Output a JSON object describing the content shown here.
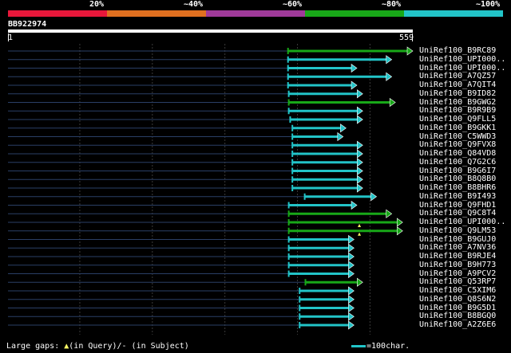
{
  "legend": {
    "labels": [
      "20%",
      "~40%",
      "~60%",
      "~80%",
      "~100%"
    ],
    "colors": [
      "#e8173a",
      "#e07020",
      "#a03a9a",
      "#18a818",
      "#22c4c8"
    ]
  },
  "query": {
    "id": "BB922974",
    "start": "1",
    "end": "559"
  },
  "hit_colors": {
    "green": "#18a818",
    "cyan": "#22c4c8",
    "gap": "#ffff66"
  },
  "hits": [
    {
      "label": "UniRef100_B9RC89",
      "start": 387,
      "end": 559,
      "color": "green"
    },
    {
      "label": "UniRef100_UPI000..",
      "start": 387,
      "end": 530,
      "color": "cyan"
    },
    {
      "label": "UniRef100_UPI000..",
      "start": 387,
      "end": 482,
      "color": "cyan"
    },
    {
      "label": "UniRef100_A7QZ57",
      "start": 387,
      "end": 530,
      "color": "cyan"
    },
    {
      "label": "UniRef100_A7QIT4",
      "start": 387,
      "end": 482,
      "color": "cyan"
    },
    {
      "label": "UniRef100_B9ID82",
      "start": 388,
      "end": 490,
      "color": "cyan"
    },
    {
      "label": "UniRef100_B9GWG2",
      "start": 388,
      "end": 535,
      "color": "green"
    },
    {
      "label": "UniRef100_B9R9B9",
      "start": 388,
      "end": 490,
      "color": "cyan"
    },
    {
      "label": "UniRef100_Q9FLL5",
      "start": 390,
      "end": 490,
      "color": "cyan"
    },
    {
      "label": "UniRef100_B9GKK1",
      "start": 393,
      "end": 467,
      "color": "cyan"
    },
    {
      "label": "UniRef100_C5WWD3",
      "start": 393,
      "end": 463,
      "color": "cyan"
    },
    {
      "label": "UniRef100_Q9FVX8",
      "start": 393,
      "end": 490,
      "color": "cyan"
    },
    {
      "label": "UniRef100_Q84VD8",
      "start": 393,
      "end": 490,
      "color": "cyan"
    },
    {
      "label": "UniRef100_Q7G2C6",
      "start": 393,
      "end": 490,
      "color": "cyan"
    },
    {
      "label": "UniRef100_B9G6I7",
      "start": 393,
      "end": 490,
      "color": "cyan"
    },
    {
      "label": "UniRef100_B8Q8B0",
      "start": 393,
      "end": 490,
      "color": "cyan"
    },
    {
      "label": "UniRef100_B8BHR6",
      "start": 393,
      "end": 490,
      "color": "cyan"
    },
    {
      "label": "UniRef100_B9I493",
      "start": 410,
      "end": 509,
      "color": "cyan"
    },
    {
      "label": "UniRef100_Q9FHD1",
      "start": 388,
      "end": 482,
      "color": "cyan"
    },
    {
      "label": "UniRef100_Q9C8T4",
      "start": 388,
      "end": 530,
      "color": "green"
    },
    {
      "label": "UniRef100_UPI000..",
      "start": 388,
      "end": 545,
      "color": "green",
      "gap": true
    },
    {
      "label": "UniRef100_Q9LM53",
      "start": 388,
      "end": 545,
      "color": "green",
      "gap": true
    },
    {
      "label": "UniRef100_B9GUJ0",
      "start": 388,
      "end": 478,
      "color": "cyan"
    },
    {
      "label": "UniRef100_A7NV36",
      "start": 388,
      "end": 478,
      "color": "cyan"
    },
    {
      "label": "UniRef100_B9RJE4",
      "start": 388,
      "end": 478,
      "color": "cyan"
    },
    {
      "label": "UniRef100_B9H773",
      "start": 388,
      "end": 478,
      "color": "cyan"
    },
    {
      "label": "UniRef100_A9PCV2",
      "start": 388,
      "end": 478,
      "color": "cyan"
    },
    {
      "label": "UniRef100_Q53RP7",
      "start": 411,
      "end": 490,
      "color": "green"
    },
    {
      "label": "UniRef100_C5XIM6",
      "start": 403,
      "end": 478,
      "color": "cyan"
    },
    {
      "label": "UniRef100_Q8S6N2",
      "start": 403,
      "end": 478,
      "color": "cyan"
    },
    {
      "label": "UniRef100_B9G5D1",
      "start": 403,
      "end": 478,
      "color": "cyan"
    },
    {
      "label": "UniRef100_B8BGQ0",
      "start": 403,
      "end": 478,
      "color": "cyan"
    },
    {
      "label": "UniRef100_A2Z6E6",
      "start": 403,
      "end": 478,
      "color": "cyan"
    }
  ],
  "footer": {
    "gaps_prefix": "Large gaps: ",
    "gap_symbol": "▲",
    "gaps_suffix": "(in Query)/- (in Subject)",
    "scale_text": "=100char."
  }
}
